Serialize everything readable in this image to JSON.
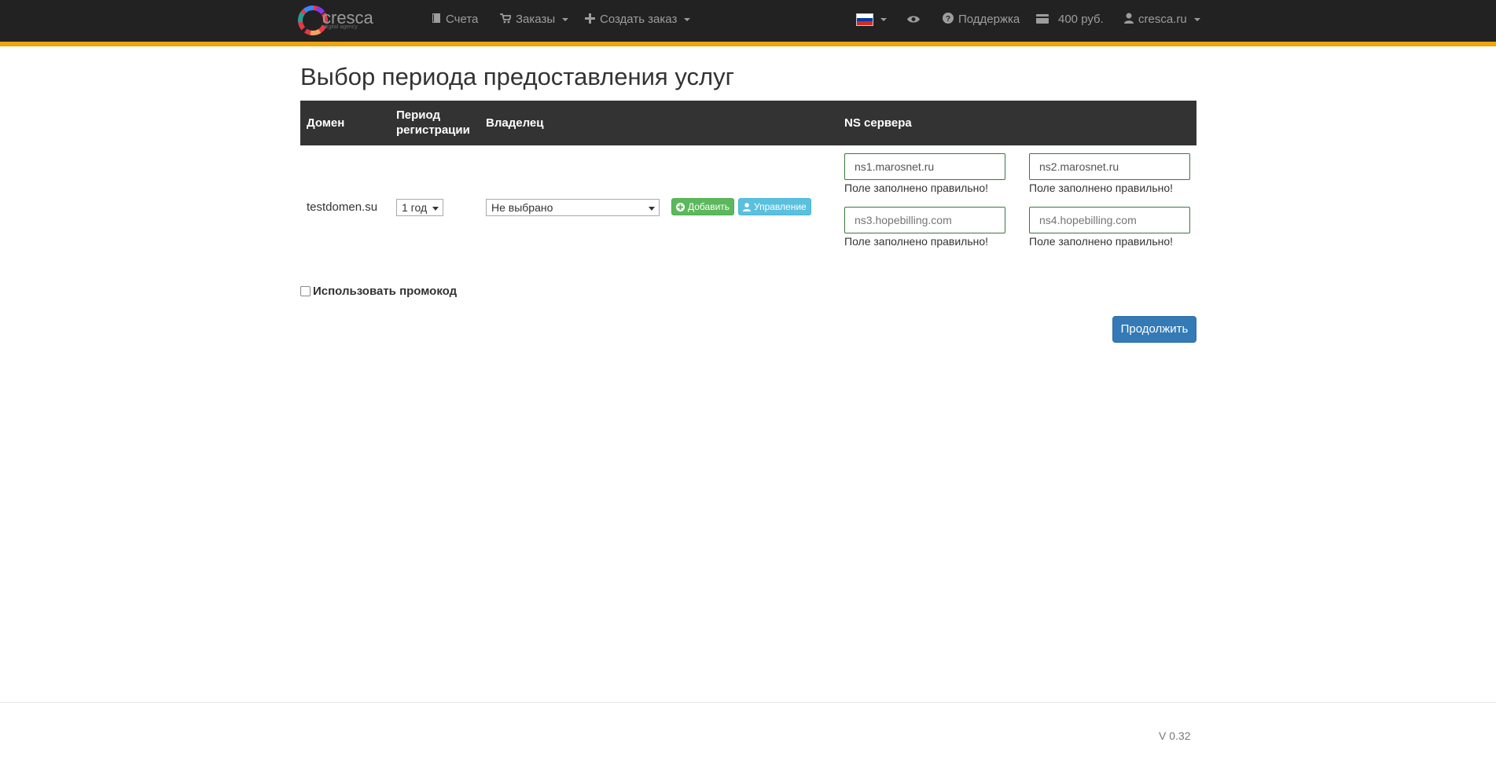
{
  "brand": {
    "name": "cresca",
    "tagline": "digital agency"
  },
  "nav": {
    "accounts": "Счета",
    "orders": "Заказы",
    "create_order": "Создать заказ",
    "support": "Поддержка",
    "balance": "400 руб.",
    "user": "cresca.ru"
  },
  "icons": {
    "accounts": "book-icon",
    "orders": "cart-icon",
    "create_order": "plus-icon",
    "language": "russian-flag-icon",
    "preview": "eye-icon",
    "support": "question-circle-icon",
    "balance": "credit-card-icon",
    "user": "user-icon"
  },
  "page": {
    "title": "Выбор периода предоставления услуг"
  },
  "table": {
    "headers": {
      "domain": "Домен",
      "period_line1": "Период",
      "period_line2": "регистрации",
      "owner": "Владелец",
      "ns": "NS сервера"
    },
    "row": {
      "domain": "testdomen.su",
      "period": "1 год",
      "owner": "Не выбрано",
      "add_button": "Добавить",
      "manage_button": "Управление",
      "ns": [
        {
          "value": "ns1.marosnet.ru",
          "placeholder": "",
          "help": "Поле заполнено правильно!"
        },
        {
          "value": "ns2.marosnet.ru",
          "placeholder": "",
          "help": "Поле заполнено правильно!"
        },
        {
          "value": "",
          "placeholder": "ns3.hopebilling.com",
          "help": "Поле заполнено правильно!"
        },
        {
          "value": "",
          "placeholder": "ns4.hopebilling.com",
          "help": "Поле заполнено правильно!"
        }
      ]
    }
  },
  "promo": {
    "label": "Использовать промокод",
    "checked": false
  },
  "continue_button": "Продолжить",
  "footer": {
    "version": "V 0.32"
  },
  "colors": {
    "navbar": "#222222",
    "accent": "#f0a30a",
    "table_header": "#333333",
    "success": "#5cb85c",
    "info": "#5bc0de",
    "primary": "#337ab7",
    "valid_border": "#3c763d"
  }
}
